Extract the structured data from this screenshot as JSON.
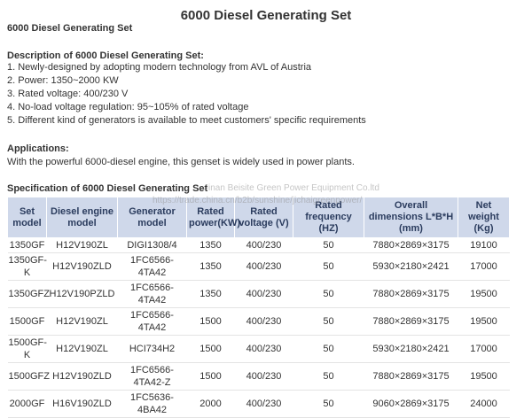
{
  "title": "6000 Diesel Generating Set",
  "subtitle": "6000 Diesel Generating Set",
  "description": {
    "heading": "Description of 6000 Diesel Generating Set:",
    "items": [
      "1. Newly-designed by adopting modern technology from AVL of Austria",
      "2. Power: 1350~2000 KW",
      "3. Rated voltage: 400/230 V",
      "4. No-load voltage regulation: 95~105% of rated voltage",
      "5. Different kind of generators is available to meet customers' specific requirements"
    ]
  },
  "applications": {
    "heading": "Applications:",
    "text": "With the powerful 6000-diesel engine, this genset is widely used in power plants."
  },
  "specification": {
    "heading": "Specification of 6000 Diesel Generating Set",
    "headers": [
      "Set model",
      "Diesel engine model",
      "Generator model",
      "Rated power(KW)",
      "Rated voltage (V)",
      "Rated frequency (HZ)",
      "Overall dimensions L*B*H (mm)",
      "Net weight (Kg)"
    ],
    "rows": [
      [
        "1350GF",
        "H12V190ZL",
        "DIGI1308/4",
        "1350",
        "400/230",
        "50",
        "7880×2869×3175",
        "19100"
      ],
      [
        "1350GF-K",
        "H12V190ZLD",
        "1FC6566-4TA42",
        "1350",
        "400/230",
        "50",
        "5930×2180×2421",
        "17000"
      ],
      [
        "1350GFZ",
        "H12V190PZLD",
        "1FC6566-4TA42",
        "1350",
        "400/230",
        "50",
        "7880×2869×3175",
        "19500"
      ],
      [
        "1500GF",
        "H12V190ZL",
        "1FC6566-4TA42",
        "1500",
        "400/230",
        "50",
        "7880×2869×3175",
        "19500"
      ],
      [
        "1500GF-K",
        "H12V190ZL",
        "HCI734H2",
        "1500",
        "400/230",
        "50",
        "5930×2180×2421",
        "17000"
      ],
      [
        "1500GFZ",
        "H12V190ZLD",
        "1FC6566-4TA42-Z",
        "1500",
        "400/230",
        "50",
        "7880×2869×3175",
        "19500"
      ],
      [
        "2000GF",
        "H16V190ZLD",
        "1FC5636-4BA42",
        "2000",
        "400/230",
        "50",
        "9060×2869×3175",
        "24000"
      ]
    ]
  },
  "watermarks": [
    "Jinan Beisite Green Power Equipment Co.ltd",
    "https://trade.china.cn/b2b/sunshine/jichaigreenpower/"
  ]
}
